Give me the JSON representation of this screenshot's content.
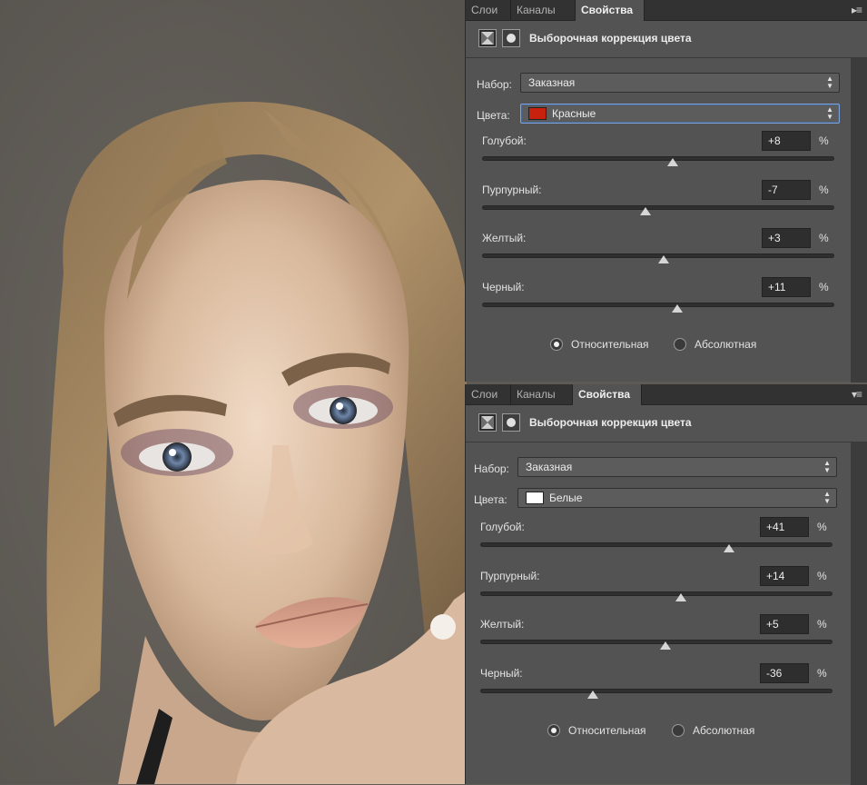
{
  "tabs": [
    "Слои",
    "Каналы",
    "Свойства"
  ],
  "panel_title": "Выборочная коррекция цвета",
  "preset_label": "Набор:",
  "colors_label": "Цвета:",
  "relative_label": "Относительная",
  "absolute_label": "Абсолютная",
  "percent": "%",
  "icons": [
    "selective-color-icon",
    "layer-mask-icon",
    "panel-menu-icon"
  ],
  "colors": {
    "red_swatch": "#c8220f",
    "white_swatch": "#ffffff"
  },
  "panels": [
    {
      "preset_value": "Заказная",
      "color_value": "Красные",
      "color_swatch": "#c8220f",
      "method": "relative",
      "sliders": [
        {
          "label": "Голубой:",
          "value": "+8",
          "num": 8
        },
        {
          "label": "Пурпурный:",
          "value": "-7",
          "num": -7
        },
        {
          "label": "Желтый:",
          "value": "+3",
          "num": 3
        },
        {
          "label": "Черный:",
          "value": "+11",
          "num": 11
        }
      ]
    },
    {
      "preset_value": "Заказная",
      "color_value": "Белые",
      "color_swatch": "#ffffff",
      "method": "relative",
      "sliders": [
        {
          "label": "Голубой:",
          "value": "+41",
          "num": 41
        },
        {
          "label": "Пурпурный:",
          "value": "+14",
          "num": 14
        },
        {
          "label": "Желтый:",
          "value": "+5",
          "num": 5
        },
        {
          "label": "Черный:",
          "value": "-36",
          "num": -36
        }
      ]
    }
  ]
}
